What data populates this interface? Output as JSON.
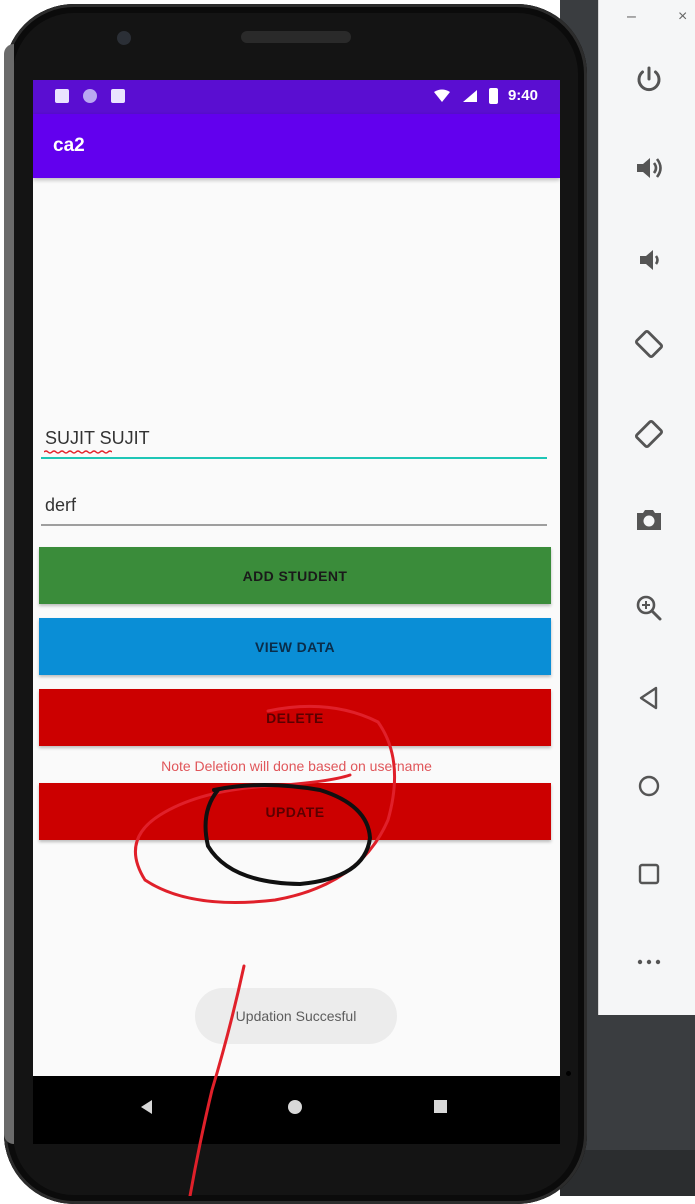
{
  "status_bar": {
    "time": "9:40"
  },
  "app_bar": {
    "title": "ca2"
  },
  "form": {
    "name_value": "SUJIT SUJIT",
    "password_value": "derf"
  },
  "buttons": {
    "add_student": "ADD STUDENT",
    "view_data": "VIEW DATA",
    "delete": "DELETE",
    "update": "UPDATE"
  },
  "note": "Note Deletion will done based on username",
  "toast": "Updation Succesful",
  "colors": {
    "status_bar": "#5a0ed1",
    "app_bar": "#6200ee",
    "add_button": "#3a8c3a",
    "view_button": "#0a8ed6",
    "delete_button": "#cc0000",
    "update_button": "#cc0000"
  },
  "toolbar_icons": [
    "power-icon",
    "volume-up-icon",
    "volume-down-icon",
    "rotate-left-icon",
    "rotate-right-icon",
    "camera-icon",
    "zoom-icon",
    "back-icon",
    "home-icon",
    "overview-icon",
    "more-icon"
  ]
}
